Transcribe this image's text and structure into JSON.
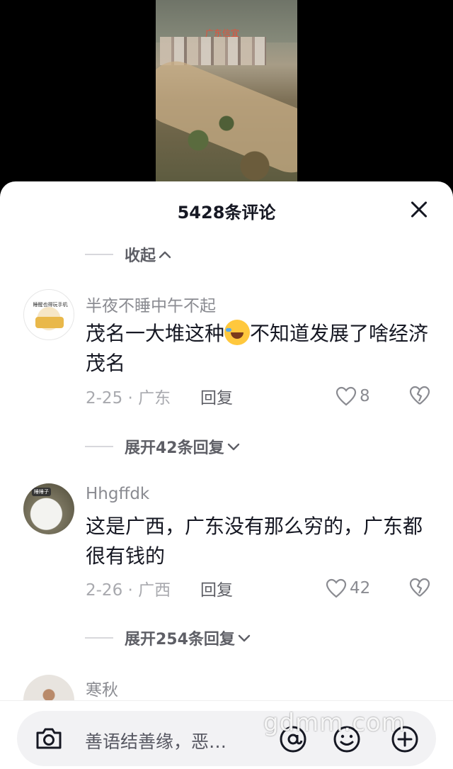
{
  "video": {
    "overlay_text": "广东信宜"
  },
  "sheet": {
    "title": "5428条评论",
    "close_icon": "close-icon"
  },
  "collapse": {
    "label": "收起",
    "chevron": "^"
  },
  "comments": [
    {
      "author": "半夜不睡中午不起",
      "avatar_text": "睡醒也得玩手机",
      "text_before": "茂名一大堆这种",
      "emoji": "laughing-crying-emoji",
      "text_after": "不知道发展了啥经济茂名",
      "date": "2-25 · 广东",
      "reply_label": "回复",
      "likes": "8",
      "expand_label": "展开42条回复"
    },
    {
      "author": "Hhgffdk",
      "avatar_text": "睡睡子",
      "text": "这是广西，广东没有那么穷的，广东都很有钱的",
      "date": "2-26 · 广西",
      "reply_label": "回复",
      "likes": "42",
      "expand_label": "展开254条回复"
    },
    {
      "author": "寒秋"
    }
  ],
  "input": {
    "placeholder": "善语结善缘，恶…"
  },
  "watermark": "gdmm.com",
  "colors": {
    "text_primary": "#161823",
    "text_secondary": "#8a8b91",
    "video_title": "#e4503a"
  }
}
